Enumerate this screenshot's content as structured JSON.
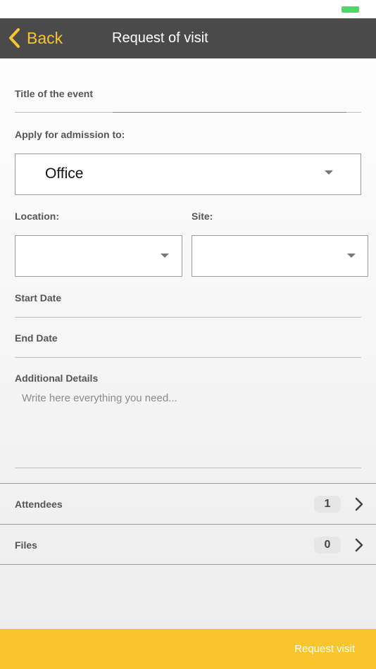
{
  "nav": {
    "back_label": "Back",
    "title": "Request of visit"
  },
  "form": {
    "event_title_label": "Title of the event",
    "event_title_value": "",
    "admission_label": "Apply for admission to:",
    "admission_value": "Office",
    "location_label": "Location:",
    "location_value": "",
    "site_label": "Site:",
    "site_value": "",
    "start_date_label": "Start Date",
    "end_date_label": "End Date",
    "details_label": "Additional Details",
    "details_placeholder": "Write here everything you need..."
  },
  "lists": {
    "attendees_label": "Attendees",
    "attendees_count": "1",
    "files_label": "Files",
    "files_count": "0"
  },
  "footer": {
    "request_label": "Request visit"
  },
  "colors": {
    "accent": "#f8c52f",
    "nav_bg": "#4a4a4a",
    "battery": "#4cd964"
  }
}
